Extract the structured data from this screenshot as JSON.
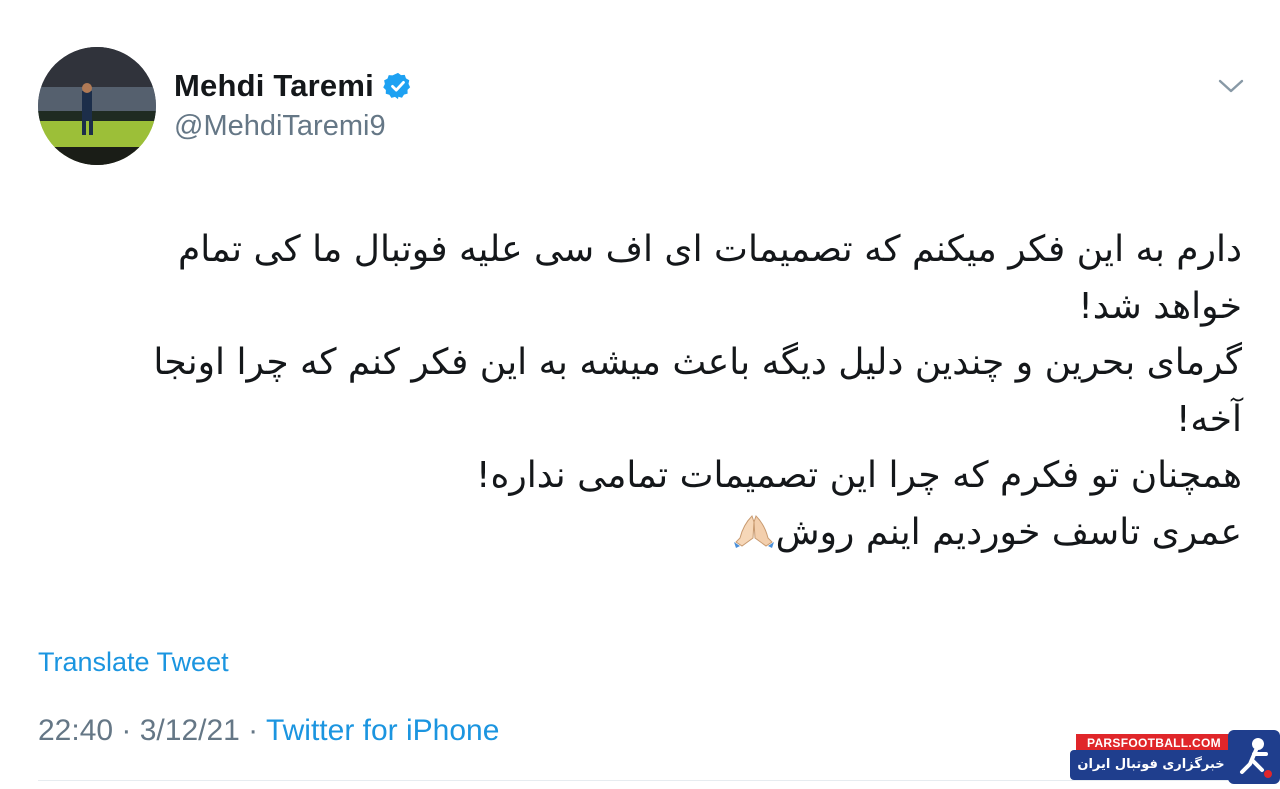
{
  "user": {
    "display_name": "Mehdi Taremi",
    "handle": "@MehdiTaremi9",
    "verified": true
  },
  "tweet": {
    "lines": [
      "دارم به این فکر میکنم که تصمیمات ای اف سی علیه فوتبال ما کی تمام",
      "خواهد شد!",
      "گرمای بحرین و چندین دلیل دیگه باعث میشه به این فکر کنم که چرا اونجا",
      "آخه!",
      "همچنان تو فکرم که چرا این تصمیمات تمامی نداره!",
      "عمری تاسف خوردیم اینم روش"
    ],
    "trailing_emoji": "folded-hands"
  },
  "translate_label": "Translate Tweet",
  "meta": {
    "time": "22:40",
    "separator": " · ",
    "date": "3/12/21",
    "source": "Twitter for iPhone"
  },
  "watermark": {
    "site": "PARSFOOTBALL.COM",
    "tagline": "خبرگزاری فوتبال ایران"
  },
  "colors": {
    "link": "#1b95e0",
    "secondary": "#657786",
    "verified_badge": "#1da1f2",
    "watermark_red": "#e0262a",
    "watermark_blue": "#1f3e8d"
  },
  "icons": {
    "verified": "verified-badge-icon",
    "caret": "chevron-down-icon",
    "emoji": "folded-hands-icon"
  }
}
